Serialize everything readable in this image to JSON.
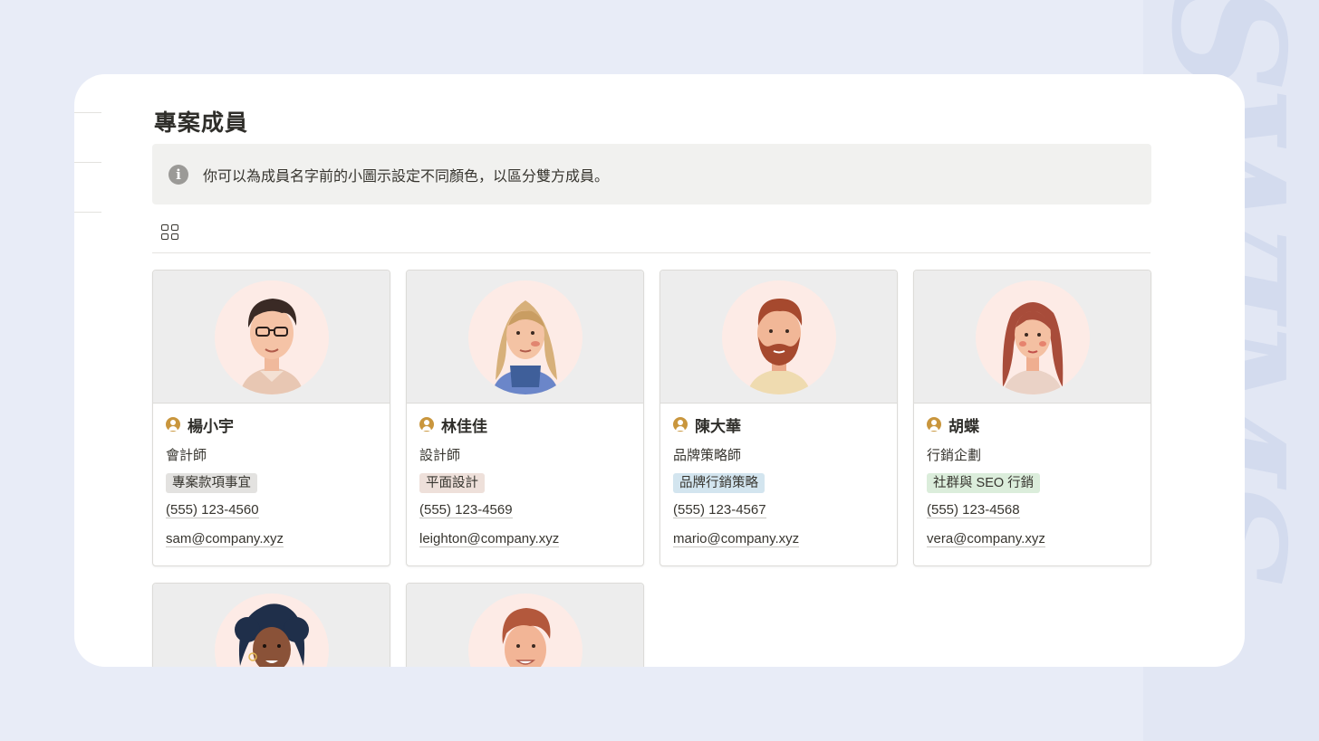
{
  "page": {
    "title": "專案成員"
  },
  "callout": {
    "icon": "info-icon",
    "text": "你可以為成員名字前的小圖示設定不同顏色，以區分雙方成員。"
  },
  "view": {
    "icon": "gallery-view-icon"
  },
  "colors": {
    "person_icon": "#c9963d",
    "tag_gray": "#e3e2e0",
    "tag_brown": "#eee0da",
    "tag_blue": "#d3e5ef",
    "tag_green": "#dbeddb",
    "avatar_bg": "#fdebe6"
  },
  "members": [
    {
      "name": "楊小宇",
      "role": "會計師",
      "tag": "專案款項事宜",
      "phone": "(555) 123-4560",
      "email": "sam@company.xyz",
      "tag_color": "#e3e2e0"
    },
    {
      "name": "林佳佳",
      "role": "設計師",
      "tag": "平面設計",
      "phone": "(555) 123-4569",
      "email": "leighton@company.xyz",
      "tag_color": "#eee0da"
    },
    {
      "name": "陳大華",
      "role": "品牌策略師",
      "tag": "品牌行銷策略",
      "phone": "(555) 123-4567",
      "email": "mario@company.xyz",
      "tag_color": "#d3e5ef"
    },
    {
      "name": "胡蝶",
      "role": "行銷企劃",
      "tag": "社群與 SEO 行銷",
      "phone": "(555) 123-4568",
      "email": "vera@company.xyz",
      "tag_color": "#dbeddb"
    }
  ]
}
